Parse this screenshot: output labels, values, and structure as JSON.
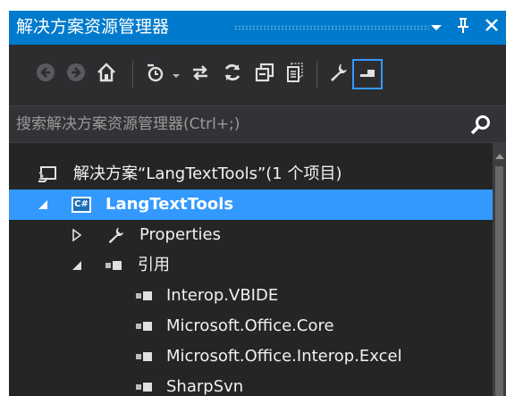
{
  "window": {
    "title": "解决方案资源管理器",
    "accent_color": "#007acc",
    "selection_color": "#3399ff",
    "title_buttons": [
      {
        "icon": "chevron-down-icon",
        "glyph": "▾"
      },
      {
        "icon": "pin-icon",
        "glyph": "ꟾ"
      },
      {
        "icon": "close-icon",
        "glyph": "✕"
      }
    ]
  },
  "toolbar": {
    "items": [
      {
        "icon": "back-icon"
      },
      {
        "icon": "forward-icon"
      },
      {
        "icon": "home-icon"
      },
      {
        "icon": "pending-changes-filter-icon"
      },
      {
        "icon": "dropdown-arrow-icon"
      },
      {
        "icon": "sync-with-active-document-icon"
      },
      {
        "icon": "refresh-icon"
      },
      {
        "icon": "collapse-all-icon"
      },
      {
        "icon": "show-all-files-icon"
      },
      {
        "icon": "properties-icon"
      },
      {
        "icon": "preview-selected-items-icon"
      }
    ]
  },
  "search": {
    "placeholder": "搜索解决方案资源管理器(Ctrl+;)",
    "icon": "search-icon"
  },
  "tree": {
    "solution": {
      "label": "解决方案“LangTextTools”(1 个项目)",
      "icon": "solution-icon"
    },
    "project": {
      "label": "LangTextTools",
      "icon": "csharp-project-icon",
      "badge": "C#",
      "expanded": true
    },
    "properties": {
      "label": "Properties",
      "icon": "wrench-icon",
      "expanded": false
    },
    "references": {
      "label": "引用",
      "icon": "references-icon",
      "expanded": true
    },
    "reference_items": [
      {
        "label": "Interop.VBIDE"
      },
      {
        "label": "Microsoft.Office.Core"
      },
      {
        "label": "Microsoft.Office.Interop.Excel"
      },
      {
        "label": "SharpSvn"
      }
    ]
  }
}
